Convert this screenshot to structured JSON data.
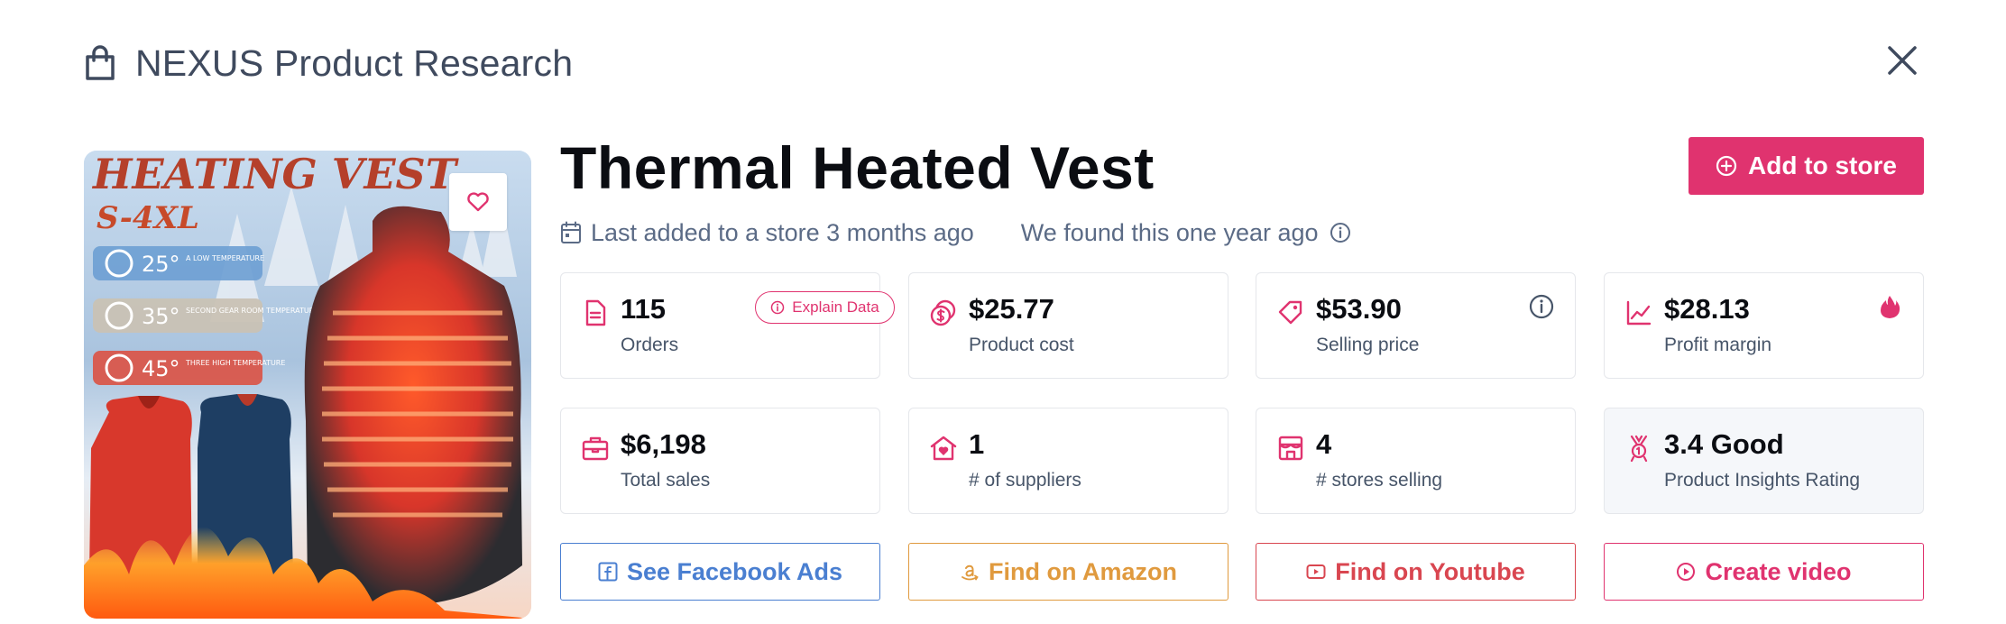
{
  "header": {
    "title": "NEXUS Product Research",
    "icon": "shopping-bag-icon"
  },
  "product": {
    "title": "Thermal Heated Vest",
    "image_text": {
      "headline": "HEATING VEST",
      "sizes": "S-4XL",
      "modes": [
        {
          "temp": "25°",
          "desc": "A LOW TEMPERATURE"
        },
        {
          "temp": "35°",
          "desc": "SECOND GEAR ROOM TEMPERATURE"
        },
        {
          "temp": "45°",
          "desc": "THREE HIGH TEMPERATURE"
        }
      ]
    }
  },
  "actions": {
    "add_to_store": "Add to store"
  },
  "meta": {
    "last_added": "Last added to a store 3 months ago",
    "found": "We found this one year ago"
  },
  "explain_button": "Explain Data",
  "stats": [
    {
      "value": "115",
      "label": "Orders",
      "icon": "document-icon"
    },
    {
      "value": "$25.77",
      "label": "Product cost",
      "icon": "coins-icon"
    },
    {
      "value": "$53.90",
      "label": "Selling price",
      "icon": "price-tag-icon"
    },
    {
      "value": "$28.13",
      "label": "Profit margin",
      "icon": "line-chart-icon"
    },
    {
      "value": "$6,198",
      "label": "Total sales",
      "icon": "briefcase-icon"
    },
    {
      "value": "1",
      "label": "# of suppliers",
      "icon": "supplier-house-icon"
    },
    {
      "value": "4",
      "label": "# stores selling",
      "icon": "storefront-icon"
    },
    {
      "value": "3.4 Good",
      "label": "Product Insights Rating",
      "icon": "award-ribbon-icon"
    }
  ],
  "buttons": {
    "facebook": "See Facebook Ads",
    "amazon": "Find on Amazon",
    "youtube": "Find on Youtube",
    "video": "Create video"
  },
  "colors": {
    "accent": "#e0336f",
    "facebook": "#4a7fd1",
    "amazon": "#e09a3e",
    "youtube": "#d94650",
    "title": "#3f4a5e",
    "muted": "#5b6b86"
  }
}
